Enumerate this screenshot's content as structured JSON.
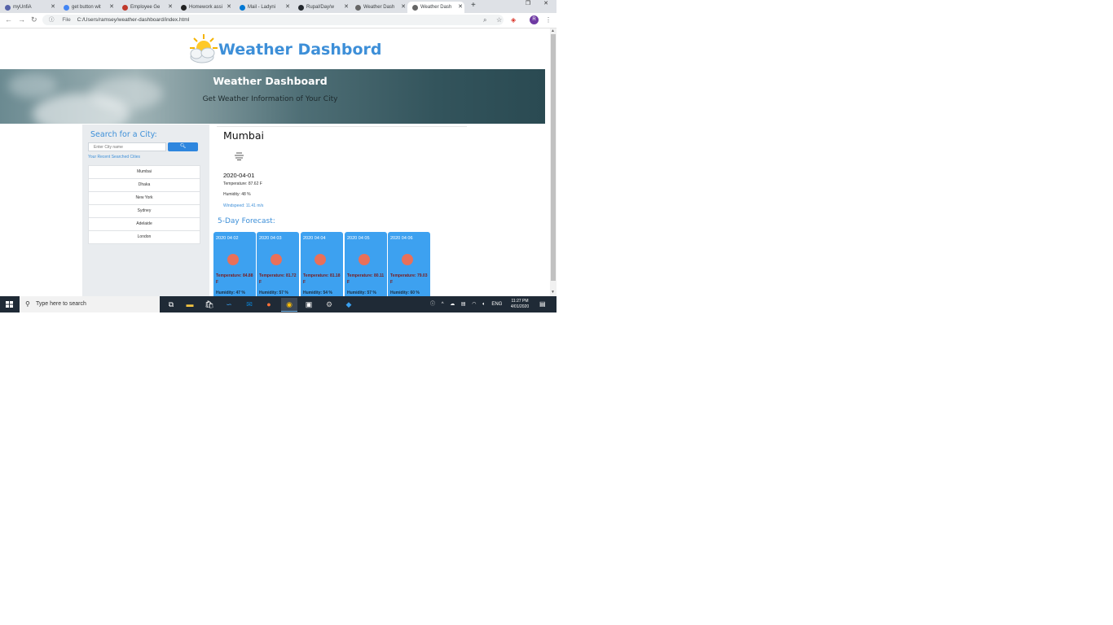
{
  "browser": {
    "tabs": [
      {
        "label": "myUnfiA",
        "icon_color": "#5562a8"
      },
      {
        "label": "get button wit",
        "icon_color": "#4285f4"
      },
      {
        "label": "Employee Ge",
        "icon_color": "#c0392b"
      },
      {
        "label": "Homework assi",
        "icon_color": "#222222"
      },
      {
        "label": "Mail - Ladyni",
        "icon_color": "#0078d4"
      },
      {
        "label": "Rupal/Day/w",
        "icon_color": "#24292e"
      },
      {
        "label": "Weather Dash",
        "icon_color": "#666666"
      },
      {
        "label": "Weather Dash",
        "icon_color": "#666666"
      }
    ],
    "new_tab": "+",
    "address": {
      "scheme": "File",
      "url": "C:/Users/ramsey/weather-dashboard/index.html"
    },
    "profile_initial": "R"
  },
  "site": {
    "brand_title": "Weather Dashbord",
    "hero_title": "Weather Dashboard",
    "hero_subtitle": "Get Weather Information of Your City"
  },
  "sidebar": {
    "search_label": "Search for a City:",
    "search_placeholder": "Enter City name",
    "recent_label": "Your Recent Searched Cities",
    "recent_cities": [
      "Mumbai",
      "Dhaka",
      "New York",
      "Sydney",
      "Adelaide",
      "London"
    ]
  },
  "current": {
    "city": "Mumbai",
    "date": "2020-04-01",
    "temperature": "Temperature: 87.62 F",
    "humidity": "Humidity: 48 %",
    "wind": "Windspeed: 11.41 m/s"
  },
  "forecast": {
    "title": "5-Day Forecast:",
    "days": [
      {
        "date": "2020 04 02",
        "temp": "Temperature: 84.88 F",
        "humidity": "Humidity: 47 %"
      },
      {
        "date": "2020 04 03",
        "temp": "Temperature: 81.72 F",
        "humidity": "Humidity: 57 %"
      },
      {
        "date": "2020 04 04",
        "temp": "Temperature: 81.18 F",
        "humidity": "Humidity: 54 %"
      },
      {
        "date": "2020 04 05",
        "temp": "Temperature: 80.11 F",
        "humidity": "Humidity: 57 %"
      },
      {
        "date": "2020 04 06",
        "temp": "Temperature: 79.03 F",
        "humidity": "Humidity: 60 %"
      }
    ]
  },
  "taskbar": {
    "search_text": "Type here to search",
    "tray_lang": "ENG",
    "clock_time": "11:27 PM",
    "clock_date": "4/01/2020"
  }
}
